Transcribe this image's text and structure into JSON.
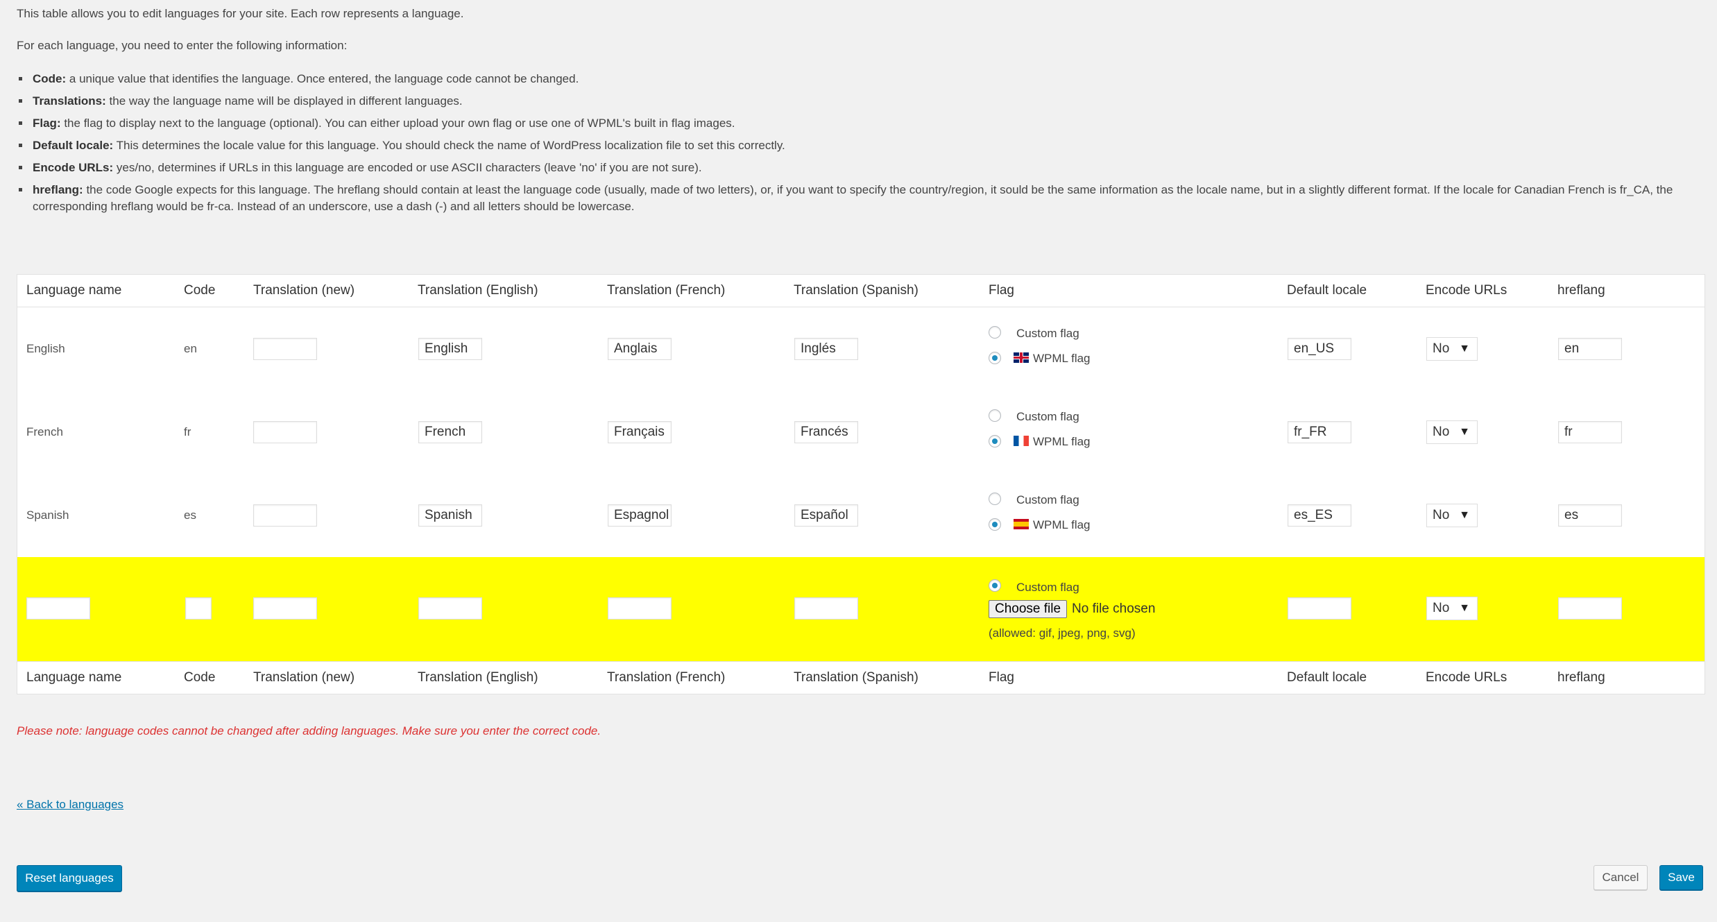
{
  "intro": {
    "p1": "This table allows you to edit languages for your site. Each row represents a language.",
    "p2": "For each language, you need to enter the following information:",
    "items": [
      {
        "term": "Code:",
        "text": " a unique value that identifies the language. Once entered, the language code cannot be changed."
      },
      {
        "term": "Translations:",
        "text": " the way the language name will be displayed in different languages."
      },
      {
        "term": "Flag:",
        "text": " the flag to display next to the language (optional). You can either upload your own flag or use one of WPML's built in flag images."
      },
      {
        "term": "Default locale:",
        "text": " This determines the locale value for this language. You should check the name of WordPress localization file to set this correctly."
      },
      {
        "term": "Encode URLs:",
        "text": " yes/no, determines if URLs in this language are encoded or use ASCII characters (leave 'no' if you are not sure)."
      },
      {
        "term": "hreflang:",
        "text": " the code Google expects for this language. The hreflang should contain at least the language code (usually, made of two letters), or, if you want to specify the country/region, it sould be the same information as the locale name, but in a slightly different format. If the locale for Canadian French is fr_CA, the corresponding hreflang would be fr-ca. Instead of an underscore, use a dash (-) and all letters should be lowercase."
      }
    ]
  },
  "table": {
    "headers": [
      "Language name",
      "Code",
      "Translation (new)",
      "Translation (English)",
      "Translation (French)",
      "Translation (Spanish)",
      "Flag",
      "Default locale",
      "Encode URLs",
      "hreflang"
    ],
    "custom_flag_label": "Custom flag",
    "wpml_flag_label": "WPML flag",
    "rows": [
      {
        "name": "English",
        "code": "en",
        "tr_new": "",
        "tr_en": "English",
        "tr_fr": "Anglais",
        "tr_es": "Inglés",
        "flag_icon": "uk-flag-icon",
        "locale": "en_US",
        "encode": "No",
        "hreflang": "en"
      },
      {
        "name": "French",
        "code": "fr",
        "tr_new": "",
        "tr_en": "French",
        "tr_fr": "Français",
        "tr_es": "Francés",
        "flag_icon": "france-flag-icon",
        "locale": "fr_FR",
        "encode": "No",
        "hreflang": "fr"
      },
      {
        "name": "Spanish",
        "code": "es",
        "tr_new": "",
        "tr_en": "Spanish",
        "tr_fr": "Espagnol",
        "tr_es": "Español",
        "flag_icon": "spain-flag-icon",
        "locale": "es_ES",
        "encode": "No",
        "hreflang": "es"
      }
    ],
    "new_row": {
      "custom_flag_label": "Custom flag",
      "choose_file": "Choose file",
      "no_file": "No file chosen",
      "allowed": "(allowed: gif, jpeg, png, svg)",
      "encode": "No",
      "highlight_color": "#ffff00"
    }
  },
  "note": "Please note: language codes cannot be changed after adding languages. Make sure you enter the correct code.",
  "back_link": "« Back to languages",
  "buttons": {
    "reset": "Reset languages",
    "cancel": "Cancel",
    "save": "Save"
  },
  "colors": {
    "primary": "#0085ba",
    "warning": "#dc3232",
    "link": "#0073aa"
  }
}
